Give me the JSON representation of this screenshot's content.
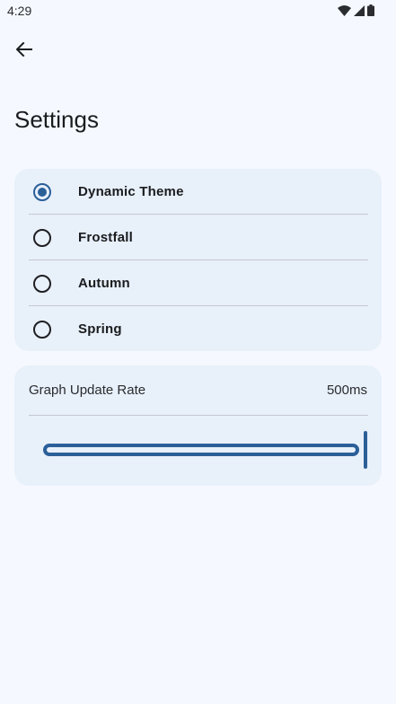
{
  "status_bar": {
    "time": "4:29"
  },
  "header": {
    "title": "Settings"
  },
  "theme_options": [
    {
      "label": "Dynamic Theme",
      "selected": true
    },
    {
      "label": "Frostfall",
      "selected": false
    },
    {
      "label": "Autumn",
      "selected": false
    },
    {
      "label": "Spring",
      "selected": false
    }
  ],
  "graph_update": {
    "label": "Graph Update Rate",
    "value": "500ms",
    "slider_level": 1.0
  },
  "colors": {
    "accent": "#2b5f98",
    "background": "#f5f9ff",
    "card": "#e8f0fa"
  }
}
